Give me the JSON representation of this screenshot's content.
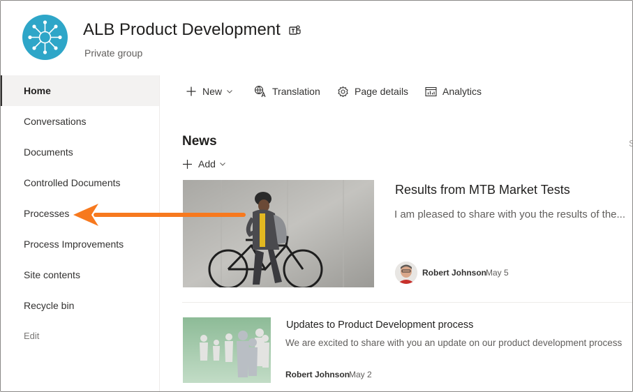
{
  "header": {
    "site_title": "ALB Product Development",
    "site_subtitle": "Private group",
    "logo_color": "#2ea6c8"
  },
  "nav": {
    "items": [
      {
        "label": "Home",
        "active": true
      },
      {
        "label": "Conversations"
      },
      {
        "label": "Documents"
      },
      {
        "label": "Controlled Documents"
      },
      {
        "label": "Processes"
      },
      {
        "label": "Process Improvements"
      },
      {
        "label": "Site contents"
      },
      {
        "label": "Recycle bin"
      }
    ],
    "edit_label": "Edit"
  },
  "commandbar": {
    "new_label": "New",
    "translation_label": "Translation",
    "page_details_label": "Page details",
    "analytics_label": "Analytics"
  },
  "news": {
    "title": "News",
    "see_all_fragment": "S",
    "add_label": "Add",
    "items": [
      {
        "title": "Results from MTB Market Tests",
        "description": "I am pleased to share with you the results of the...",
        "author": "Robert Johnson",
        "date": "May 5"
      },
      {
        "title": "Updates to Product Development process",
        "description": "We are excited to share with you an update on our product development process",
        "author": "Robert Johnson",
        "date": "May 2"
      }
    ]
  },
  "annotation": {
    "arrow_color": "#f7791e",
    "points_to": "Processes"
  }
}
